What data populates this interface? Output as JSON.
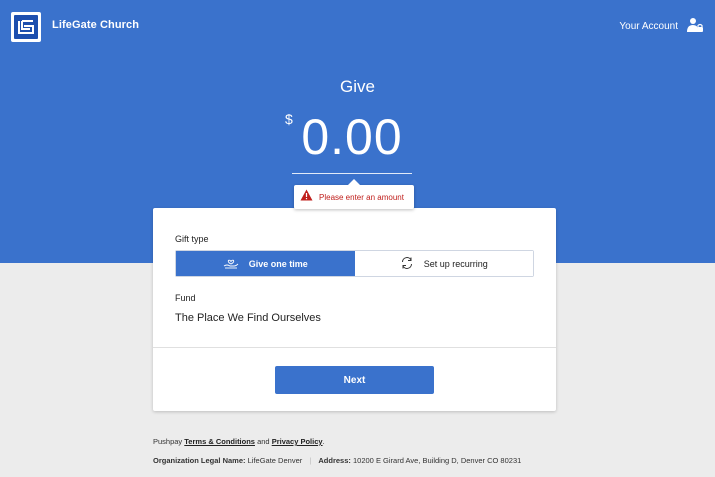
{
  "header": {
    "org_name": "LifeGate Church",
    "account_label": "Your Account",
    "logo_icon": "church-logo-icon",
    "account_icon": "user-lock-icon"
  },
  "hero": {
    "title": "Give",
    "currency_symbol": "$",
    "amount": "0.00",
    "error_message": "Please enter an amount",
    "error_icon": "warning-triangle-icon"
  },
  "card": {
    "gift_type_label": "Gift type",
    "options": [
      {
        "label": "Give one time",
        "icon": "hand-heart-icon",
        "selected": true
      },
      {
        "label": "Set up recurring",
        "icon": "recurring-arrows-icon",
        "selected": false
      }
    ],
    "fund_label": "Fund",
    "fund_value": "The Place We Find Ourselves",
    "next_label": "Next"
  },
  "footer": {
    "prefix": "Pushpay",
    "terms_link": "Terms & Conditions",
    "and_text": "and",
    "privacy_link": "Privacy Policy",
    "period": ".",
    "legal_name_label": "Organization Legal Name:",
    "legal_name_value": "LifeGate Denver",
    "address_label": "Address:",
    "address_value": "10200 E Girard Ave, Building D, Denver CO 80231"
  },
  "colors": {
    "brand_blue": "#3a72cc",
    "error_red": "#c0201d",
    "page_background": "#ececec"
  }
}
